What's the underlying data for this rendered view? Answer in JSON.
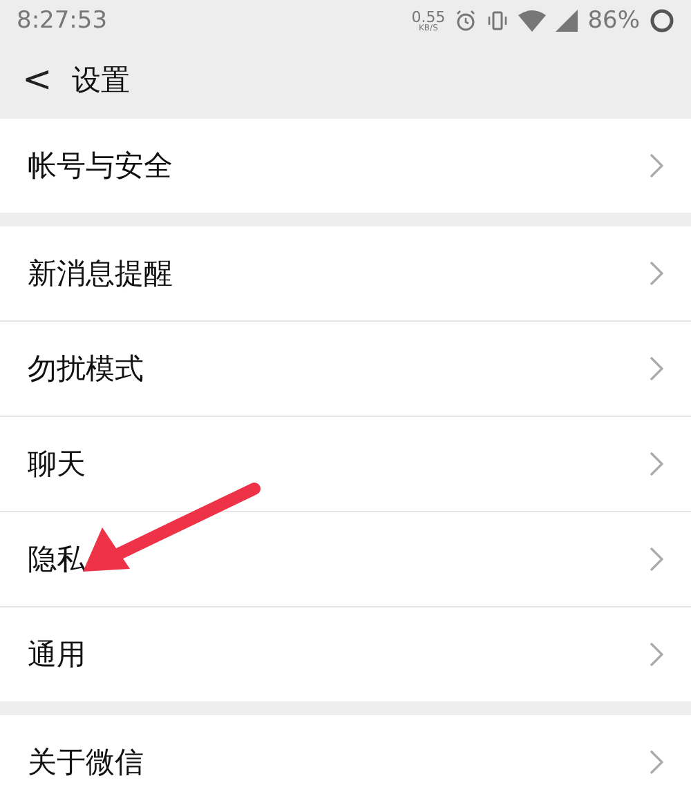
{
  "status_bar": {
    "time": "8:27:53",
    "speed": "0.55",
    "speed_unit": "KB/S",
    "battery": "86%"
  },
  "header": {
    "back": "<",
    "title": "设置"
  },
  "groups": [
    {
      "items": [
        {
          "label": "帐号与安全"
        }
      ]
    },
    {
      "items": [
        {
          "label": "新消息提醒"
        },
        {
          "label": "勿扰模式"
        },
        {
          "label": "聊天"
        },
        {
          "label": "隐私"
        },
        {
          "label": "通用"
        }
      ]
    },
    {
      "items": [
        {
          "label": "关于微信"
        }
      ]
    }
  ]
}
